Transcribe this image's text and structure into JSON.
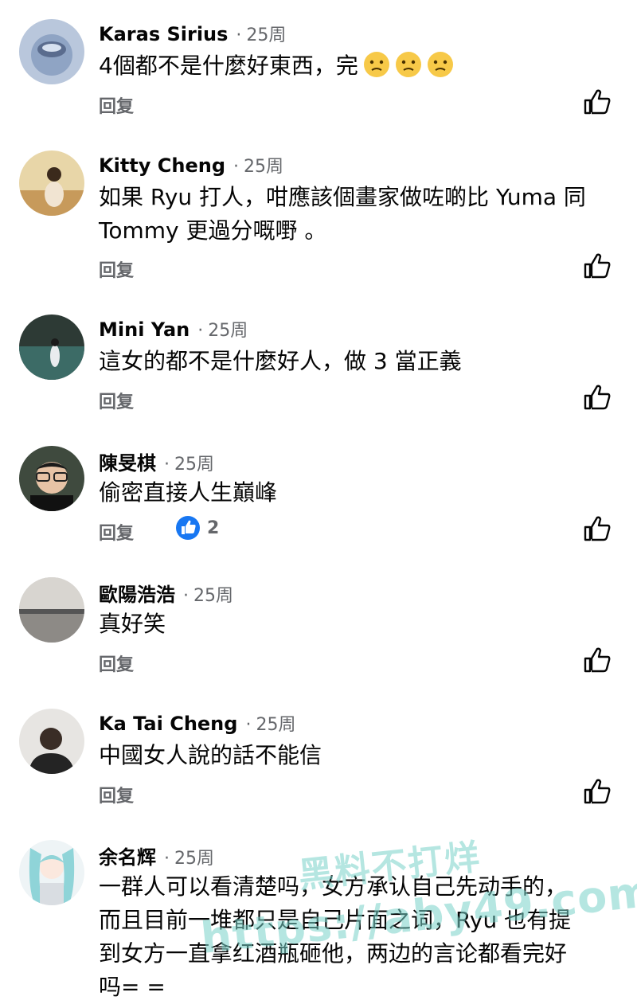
{
  "ui": {
    "reply_label": "回复",
    "time_separator": "·"
  },
  "comments": [
    {
      "author": "Karas Sirius",
      "time": "25周",
      "text": "4個都不是什麼好東西，完",
      "emoji": [
        "confused-face",
        "confused-face",
        "confused-face"
      ]
    },
    {
      "author": "Kitty Cheng",
      "time": "25周",
      "line1": "如果 Ryu 打人，咁應該個畫家做咗啲比 Yuma 同",
      "line2": "Tommy 更過分嘅嘢 。"
    },
    {
      "author": "Mini Yan",
      "time": "25周",
      "text": "這女的都不是什麼好人，做 3 當正義"
    },
    {
      "author": "陳旻棋",
      "time": "25周",
      "text": "偷密直接人生巔峰",
      "reaction_count": "2",
      "reaction_icon": "like-reaction-icon"
    },
    {
      "author": "歐陽浩浩",
      "time": "25周",
      "text": "真好笑"
    },
    {
      "author": "Ka Tai Cheng",
      "time": "25周",
      "text": "中國女人說的話不能信"
    },
    {
      "author": "余名辉",
      "time": "25周",
      "line1": "一群人可以看清楚吗，女方承认自己先动手的，",
      "line2": "而且目前一堆都只是自己片面之词，Ryu 也有提",
      "line3": "到女方一直拿红酒瓶砸他，两边的言论都看完好",
      "line4": "吗= ="
    }
  ],
  "watermark": {
    "line1": "黑料不打烊",
    "line2": "https://aby49.com"
  },
  "colors": {
    "text": "#050505",
    "secondary": "#65676b",
    "like_blue": "#1877f2"
  }
}
